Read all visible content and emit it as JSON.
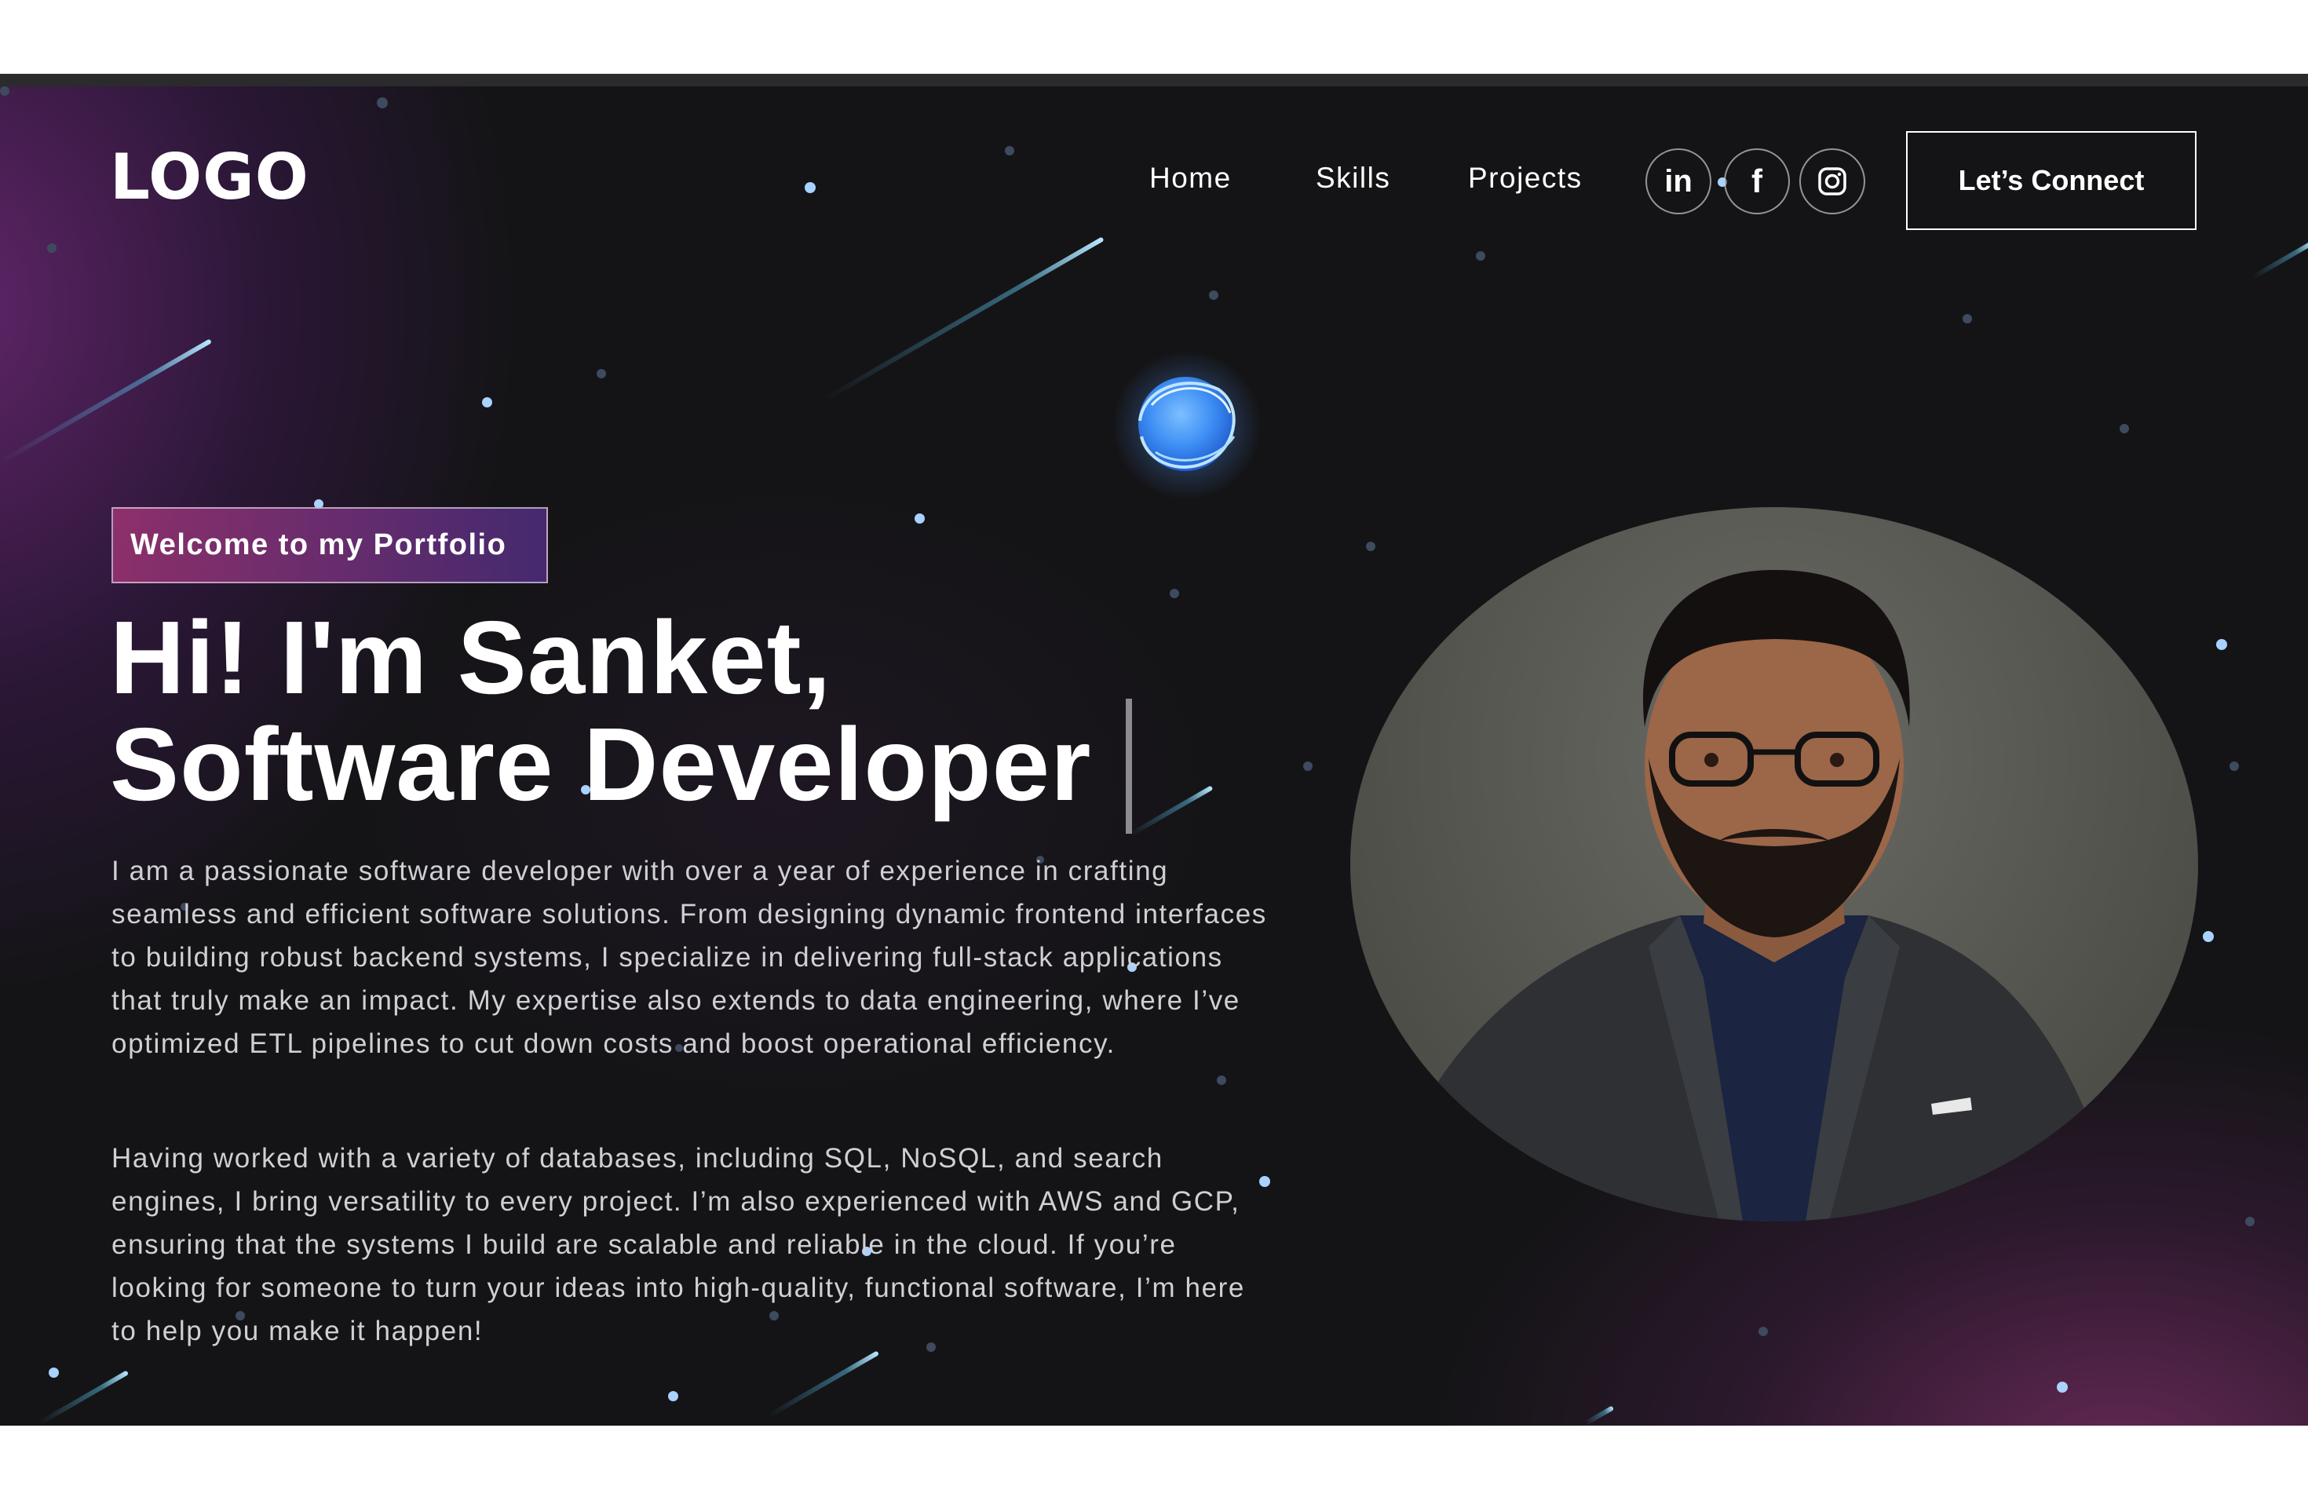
{
  "brand": {
    "logo_text": "LOGO"
  },
  "nav": {
    "links": [
      "Home",
      "Skills",
      "Projects"
    ],
    "social_icons": [
      "linkedin-icon",
      "facebook-icon",
      "instagram-icon"
    ],
    "cta_label": "Let’s Connect"
  },
  "hero": {
    "badge": "Welcome to my Portfolio",
    "headline_line1": "Hi! I'm Sanket,",
    "headline_line2": "Software Developer",
    "paragraph1": "I am a passionate software developer with over a year of experience in crafting seamless and efficient software solutions. From designing dynamic frontend interfaces to building robust backend systems, I specialize in delivering full-stack applications that truly make an impact. My expertise also extends to data engineering, where I’ve optimized ETL pipelines to cut down costs and boost operational efficiency.",
    "paragraph2": "Having worked with a variety of databases, including SQL, NoSQL, and search engines, I bring versatility to every project. I’m also experienced with AWS and GCP, ensuring that the systems I build are scalable and reliable in the cloud. If you’re looking for someone to turn your ideas into high-quality, functional software, I’m here to help you make it happen!"
  },
  "colors": {
    "background": "#141416",
    "accent_purple": "#6e2878",
    "accent_blue": "#4aa3ff",
    "text_muted": "#cfcfd4"
  }
}
